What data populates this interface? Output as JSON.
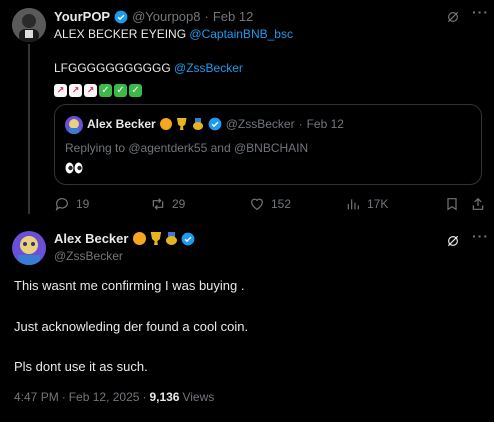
{
  "tweet1": {
    "display_name": "YourPOP",
    "handle": "@Yourpop8",
    "sep": "·",
    "date": "Feb 12",
    "line1_text": "ALEX BECKER EYEING ",
    "line1_mention": "@CaptainBNB_bsc",
    "line2_text": "LFGGGGGGGGGGG ",
    "line2_mention": "@ZssBecker",
    "emoji_row": [
      "chart-increasing",
      "chart-increasing",
      "chart-increasing",
      "check-mark-button",
      "check-mark-button",
      "check-mark-button"
    ]
  },
  "quote": {
    "display_name": "Alex Becker",
    "badges": [
      "orange",
      "trophy",
      "medal"
    ],
    "handle": "@ZssBecker",
    "sep": "·",
    "date": "Feb 12",
    "replying_text": "Replying to @agentderk55 and @BNBCHAIN",
    "body_emoji": "eyes"
  },
  "actions": {
    "replies": "19",
    "reposts": "29",
    "likes": "152",
    "views": "17K"
  },
  "tweet2": {
    "display_name": "Alex Becker",
    "badges": [
      "orange",
      "trophy",
      "medal"
    ],
    "handle": "@ZssBecker",
    "lines": [
      "This wasnt me confirming I was buying .",
      "Just acknowleding der found a cool coin.",
      "Pls dont use it as such."
    ],
    "time": "4:47 PM",
    "sep1": "·",
    "date": "Feb 12, 2025",
    "sep2": "·",
    "views_count": "9,136",
    "views_label": "Views"
  },
  "colors": {
    "background": "#000000",
    "text": "#e7e9ea",
    "muted": "#71767b",
    "accent": "#1d9bf0",
    "border": "#2f3336"
  }
}
